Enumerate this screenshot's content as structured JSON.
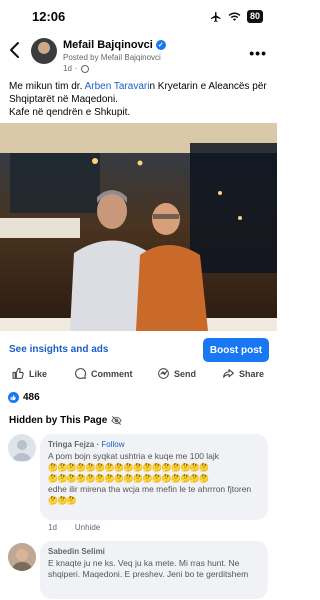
{
  "status_bar": {
    "time": "12:06",
    "battery": "80"
  },
  "post": {
    "author": "Mefail Bajqinovci",
    "posted_by": "Posted by Mefail Bajqinovci",
    "age": "1d",
    "text_prefix": "Me mikun tim dr. ",
    "tagged_person": "Arben Taravari",
    "text_suffix": "n Kryetarin e Aleancës për Shqiptarët në Maqedoni.",
    "text_line2": "Kafe në qendrën e Shkupit."
  },
  "insights": {
    "link": "See insights and ads",
    "boost": "Boost post"
  },
  "actions": {
    "like": "Like",
    "comment": "Comment",
    "send": "Send",
    "share": "Share"
  },
  "reactions": {
    "count": "486"
  },
  "comments_section": {
    "title": "Hidden by This Page"
  },
  "comments": [
    {
      "name": "Tringa Fejza",
      "follow": "Follow",
      "text": "A pom bojn syqkat ushtria e kuqe me 100 lajk",
      "emojis_line1": "🤔🤔🤔🤔🤔🤔🤔🤔🤔🤔🤔🤔🤔🤔🤔🤔🤔",
      "emojis_line2": "🤔🤔🤔🤔🤔🤔🤔🤔🤔🤔🤔🤔🤔🤔🤔🤔🤔",
      "text2": "edhe ilir mirena tha wcja me mefin le te ahrrron fjtoren",
      "emojis_end": "🤔🤔🤔",
      "age": "1d",
      "unhide": "Unhide"
    },
    {
      "name": "Sabedin Selimi",
      "text": "E knaqte ju ne ks. Veq ju ka mete. Mi rras hunt. Ne shqiperi. Maqedoni. E preshev. Jeni bo te gerditshem"
    }
  ],
  "colors": {
    "accent": "#1877f2",
    "link": "#1b5fc5",
    "bubble": "#f0f2f5"
  },
  "icons": [
    "back-arrow-icon",
    "verified-badge-icon",
    "globe-icon",
    "more-icon",
    "like-icon",
    "comment-icon",
    "send-icon",
    "share-icon",
    "eye-off-icon"
  ]
}
